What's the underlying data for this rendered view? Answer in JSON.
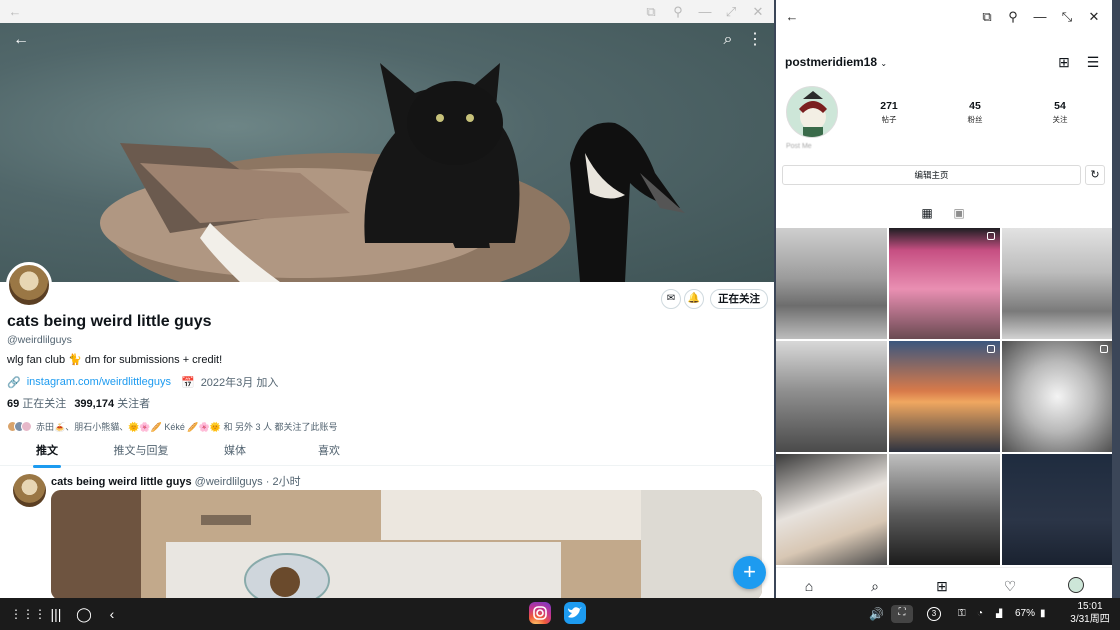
{
  "twitter": {
    "profile_name": "cats being weird little guys",
    "handle": "@weirdlilguys",
    "bio": "wlg fan club 🐈 dm for submissions + credit!",
    "link": "instagram.com/weirdlittleguys",
    "joined": "2022年3月 加入",
    "following_count": "69",
    "following_label": "正在关注",
    "followers_count": "399,174",
    "followers_label": "关注者",
    "followers_you_know": "赤田🍝、朋石小熊貓、🌞🌸🥖 Kéké 🥖🌸🌞 和 另外 3 人 都关注了此账号",
    "follow_button": "正在关注",
    "tabs": [
      "推文",
      "推文与回复",
      "媒体",
      "喜欢"
    ],
    "tweet": {
      "name": "cats being weird little guys",
      "handle": "@weirdlilguys",
      "time": "· 2小时"
    },
    "fab": "+"
  },
  "instagram": {
    "username": "postmeridiem18",
    "posts_count": "271",
    "posts_label": "帖子",
    "followers_count": "45",
    "followers_label": "粉丝",
    "following_count": "54",
    "following_label": "关注",
    "bio_blurred": "Post Me",
    "edit_profile": "编辑主页"
  },
  "taskbar": {
    "time": "15:01",
    "date": "3/31周四",
    "battery": "67%",
    "notification_count": "3"
  },
  "colors": {
    "twitter_blue": "#1d9bf0",
    "taskbar_bg": "#1b1b1b"
  }
}
